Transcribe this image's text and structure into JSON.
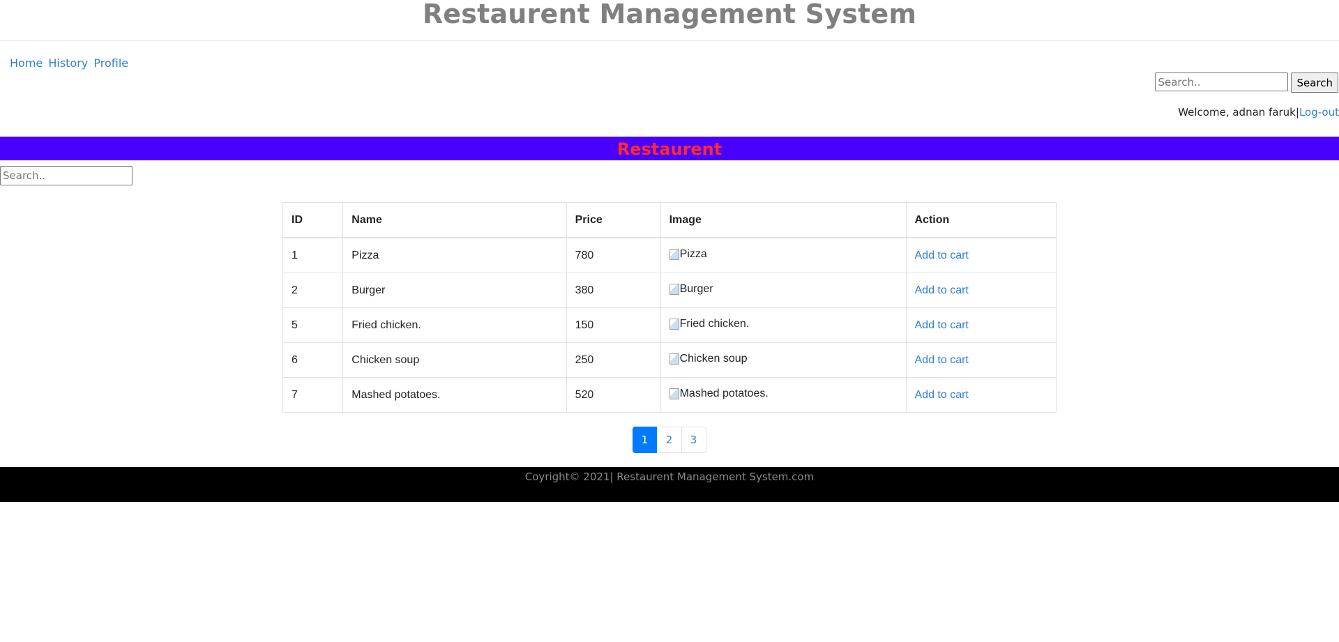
{
  "header": {
    "title": "Restaurent Management System"
  },
  "nav": {
    "items": [
      "Home",
      "History",
      "Profile"
    ]
  },
  "top_search": {
    "placeholder": "Search..",
    "button_label": "Search"
  },
  "user": {
    "welcome_text": "Welcome, adnan faruk",
    "separator": "|",
    "logout_label": "Log-out"
  },
  "banner": {
    "title": "Restaurent",
    "background": "#4a00ff",
    "text_color": "#ff2a2a"
  },
  "filter": {
    "placeholder": "Search.."
  },
  "table": {
    "headers": [
      "ID",
      "Name",
      "Price",
      "Image",
      "Action"
    ],
    "rows": [
      {
        "id": "1",
        "name": "Pizza",
        "price": "780",
        "image_alt": "Pizza",
        "action": "Add to cart"
      },
      {
        "id": "2",
        "name": "Burger",
        "price": "380",
        "image_alt": "Burger",
        "action": "Add to cart"
      },
      {
        "id": "5",
        "name": "Fried chicken.",
        "price": "150",
        "image_alt": "Fried chicken.",
        "action": "Add to cart"
      },
      {
        "id": "6",
        "name": "Chicken soup",
        "price": "250",
        "image_alt": "Chicken soup",
        "action": "Add to cart"
      },
      {
        "id": "7",
        "name": "Mashed potatoes.",
        "price": "520",
        "image_alt": "Mashed potatoes.",
        "action": "Add to cart"
      }
    ]
  },
  "pagination": {
    "pages": [
      "1",
      "2",
      "3"
    ],
    "active": "1"
  },
  "footer": {
    "text": "Coyright© 2021| Restaurent Management System.com"
  },
  "colors": {
    "link": "#2f7fd4",
    "active_page": "#007bff",
    "footer_bg": "#000000"
  }
}
